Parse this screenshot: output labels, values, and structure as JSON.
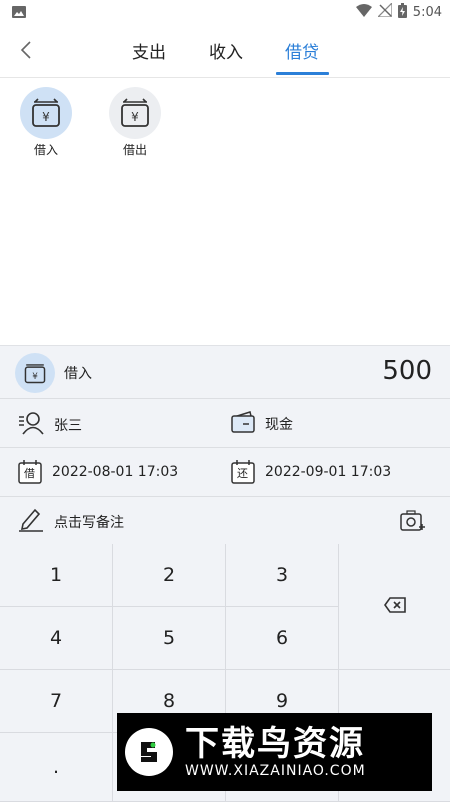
{
  "status": {
    "time": "5:04",
    "icons": [
      "image-icon",
      "wifi-icon",
      "signal-off-icon",
      "battery-icon"
    ]
  },
  "tabs": [
    "支出",
    "收入",
    "借贷"
  ],
  "active_tab": "借贷",
  "categories": [
    {
      "label": "借入",
      "selected": true
    },
    {
      "label": "借出",
      "selected": false
    }
  ],
  "entry": {
    "type_label": "借入",
    "amount": "500",
    "person": "张三",
    "account": "现金",
    "borrow_date": "2022-08-01 17:03",
    "borrow_badge": "借",
    "return_date": "2022-09-01 17:03",
    "return_badge": "还",
    "note_placeholder": "点击写备注"
  },
  "keypad": {
    "keys": [
      "1",
      "2",
      "3",
      "4",
      "5",
      "6",
      "7",
      "8",
      "9",
      "."
    ]
  },
  "watermark": {
    "title": "下载鸟资源",
    "url": "WWW.XIAZAINIAO.COM"
  },
  "colors": {
    "accent": "#2b7fd8",
    "selected_circle": "#cfe1f5",
    "panel": "#f1f3f7"
  }
}
